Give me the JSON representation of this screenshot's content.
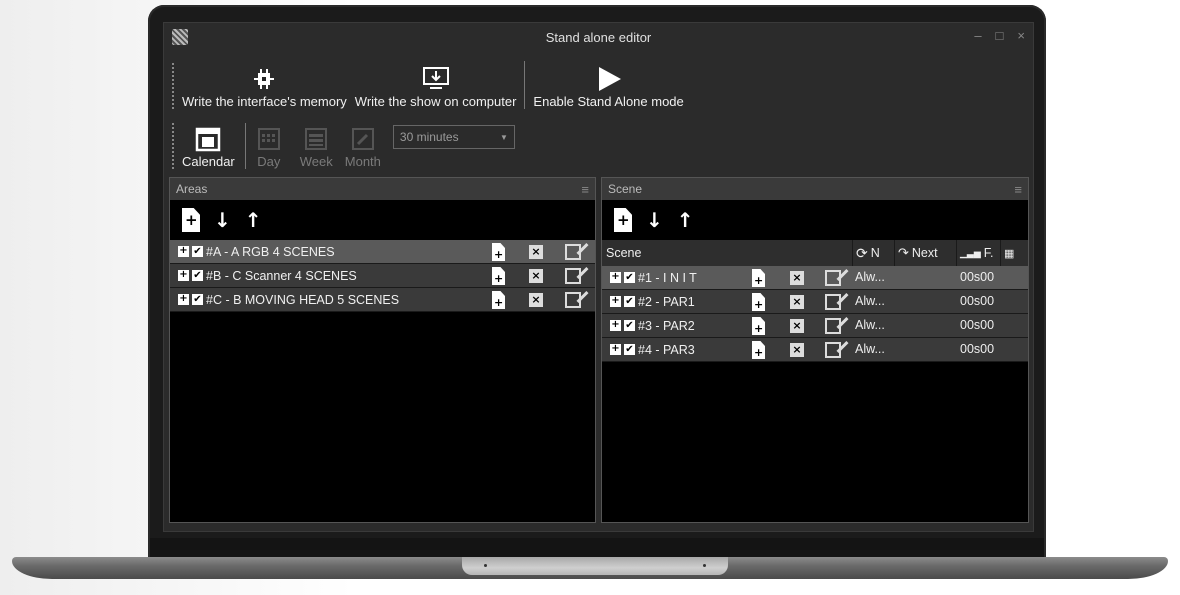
{
  "window": {
    "title": "Stand alone editor",
    "controls": [
      "–",
      "□",
      "×"
    ]
  },
  "ribbon": {
    "write_memory": "Write the interface's memory",
    "write_show": "Write the show on computer",
    "enable_standalone": "Enable Stand Alone mode",
    "calendar": "Calendar",
    "day": "Day",
    "week": "Week",
    "month": "Month",
    "interval": "30 minutes"
  },
  "areas": {
    "title": "Areas",
    "rows": [
      {
        "label": "#A - A RGB 4 SCENES"
      },
      {
        "label": "#B - C Scanner 4 SCENES"
      },
      {
        "label": "#C - B MOVING HEAD 5 SCENES"
      }
    ]
  },
  "scene": {
    "title": "Scene",
    "columns": {
      "name": "Scene",
      "n": "N",
      "next": "Next",
      "f": "F."
    },
    "rows": [
      {
        "label": "#1 - I N I T",
        "mode": "Alw...",
        "time": "00s00"
      },
      {
        "label": "#2 - PAR1",
        "mode": "Alw...",
        "time": "00s00"
      },
      {
        "label": "#3 - PAR2",
        "mode": "Alw...",
        "time": "00s00"
      },
      {
        "label": "#4 - PAR3",
        "mode": "Alw...",
        "time": "00s00"
      }
    ]
  },
  "icons": [
    "chip-icon",
    "download-monitor-icon",
    "play-icon",
    "calendar-icon",
    "add-file-icon",
    "arrow-down-icon",
    "arrow-up-icon",
    "delete-icon",
    "edit-icon"
  ]
}
